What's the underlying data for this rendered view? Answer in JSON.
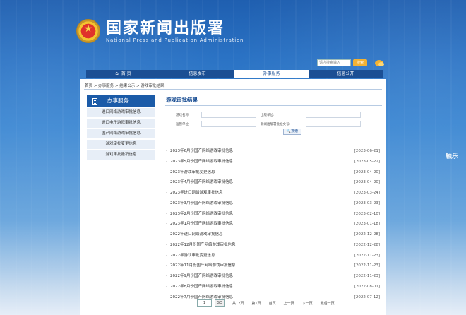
{
  "header": {
    "title_cn": "国家新闻出版署",
    "title_en": "National Press and Publication Administration"
  },
  "top_search": {
    "placeholder": "请内搜索输入",
    "button_label": "搜索"
  },
  "nav": {
    "items": [
      {
        "label": "首 页"
      },
      {
        "label": "信息发布"
      },
      {
        "label": "办事服务"
      },
      {
        "label": "信息公开"
      }
    ],
    "active_index": 2
  },
  "breadcrumb": "首页 > 办事服务 > 结果公示 > 游戏审批结果",
  "sidebar": {
    "title": "办事服务",
    "items": [
      {
        "label": "进口网络游戏审批信息"
      },
      {
        "label": "进口电子游戏审批信息"
      },
      {
        "label": "国产网络游戏审批信息"
      },
      {
        "label": "游戏审批变更信息"
      },
      {
        "label": "游戏审批撤销信息"
      }
    ]
  },
  "main": {
    "title": "游戏审批结果",
    "form": {
      "game_name": "游戏名称:",
      "publisher": "出版单位:",
      "operator": "运营单位:",
      "approval_no": "新闻出版署批准文号:",
      "search_label": "搜索"
    },
    "list": [
      {
        "title": "2023年6月份国产网络游戏审批信息",
        "date": "[2023-06-21]"
      },
      {
        "title": "2023年5月份国产网络游戏审批信息",
        "date": "[2023-05-22]"
      },
      {
        "title": "2023年游戏审批变更信息",
        "date": "[2023-04-20]"
      },
      {
        "title": "2023年4月份国产网络游戏审批信息",
        "date": "[2023-04-20]"
      },
      {
        "title": "2023年进口网络游戏审批信息",
        "date": "[2023-03-24]"
      },
      {
        "title": "2023年3月份国产网络游戏审批信息",
        "date": "[2023-03-23]"
      },
      {
        "title": "2023年2月份国产网络游戏审批信息",
        "date": "[2023-02-10]"
      },
      {
        "title": "2023年1月份国产网络游戏审批信息",
        "date": "[2023-01-18]"
      },
      {
        "title": "2022年进口网络游戏审批信息",
        "date": "[2022-12-28]"
      },
      {
        "title": "2022年12月份国产网络游戏审批信息",
        "date": "[2022-12-28]"
      },
      {
        "title": "2022年游戏审批变更信息",
        "date": "[2022-11-23]"
      },
      {
        "title": "2022年11月份国产网络游戏审批信息",
        "date": "[2022-11-23]"
      },
      {
        "title": "2022年9月份国产网络游戏审批信息",
        "date": "[2022-11-23]"
      },
      {
        "title": "2022年8月份国产网络游戏审批信息",
        "date": "[2022-08-01]"
      },
      {
        "title": "2022年7月份国产网络游戏审批信息",
        "date": "[2022-07-12]"
      }
    ]
  },
  "pager": {
    "page_value": "1",
    "go_label": "GO",
    "total": "共12页",
    "current": "第1页",
    "first": "首页",
    "prev": "上一页",
    "next": "下一页",
    "last": "最后一页"
  },
  "watermark": "触乐",
  "colors": {
    "nav_bg": "#1b4f94",
    "accent": "#1b5ba8",
    "search_btn": "#f2b233"
  }
}
